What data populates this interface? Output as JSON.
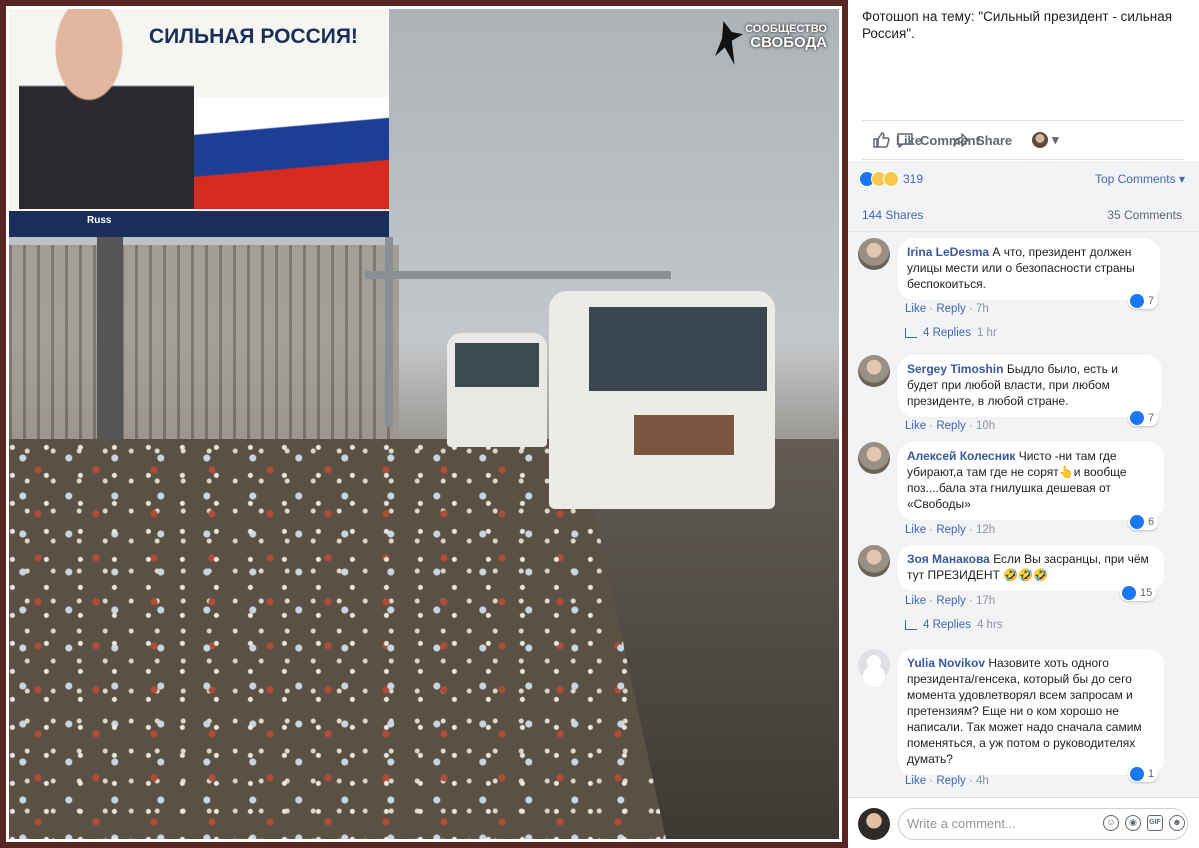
{
  "post": {
    "text": "Фотошоп на тему: \"Сильный президент - сильная Россия\".",
    "actions": {
      "like": "Like",
      "comment": "Comment",
      "share": "Share"
    }
  },
  "photo": {
    "billboard_text": "СИЛЬНАЯ РОССИЯ!",
    "billboard_brand": "Russ",
    "logo_line1": "СООБЩЕСТВО",
    "logo_line2": "СВОБОДА"
  },
  "stats": {
    "reaction_count": "319",
    "top_comments": "Top Comments ▾",
    "shares": "144 Shares",
    "comments": "35 Comments"
  },
  "comments": [
    {
      "name": "Irina LeDesma",
      "text": "А что, президент должен улицы мести или о безопасности страны беспокоиться.",
      "like": "Like",
      "reply": "Reply",
      "time": "7h",
      "likes": "7",
      "replies": "4 Replies",
      "replies_time": "1 hr"
    },
    {
      "name": "Sergey Timoshin",
      "text": "Быдло было, есть и будет при любой власти, при любом президенте, в любой стране.",
      "like": "Like",
      "reply": "Reply",
      "time": "10h",
      "likes": "7"
    },
    {
      "name": "Алексей Колесник",
      "text": "Чисто -ни там где убирают,а там где не сорят👆и вообще поз....бала эта гнилушка дешевая от «Свободы»",
      "like": "Like",
      "reply": "Reply",
      "time": "12h",
      "likes": "6"
    },
    {
      "name": "Зоя Манакова",
      "text": "Если Вы засранцы, при чём тут ПРЕЗИДЕНТ 🤣🤣🤣",
      "like": "Like",
      "reply": "Reply",
      "time": "17h",
      "likes": "15",
      "replies": "4 Replies",
      "replies_time": "4 hrs"
    },
    {
      "name": "Yulia Novikov",
      "text": "Назовите хоть одного президента/генсека, который бы до сего момента удовлетворял всем запросам и претензиям? Еще ни о ком хорошо не написали. Так может надо сначала самим поменяться, а уж потом о руководителях думать?",
      "like": "Like",
      "reply": "Reply",
      "time": "4h",
      "likes": "1"
    }
  ],
  "composer": {
    "placeholder": "Write a comment..."
  },
  "colors": {
    "link": "#4267b2",
    "name": "#385898",
    "panel_bg": "#f2f3f5",
    "frame": "#5a2626"
  }
}
